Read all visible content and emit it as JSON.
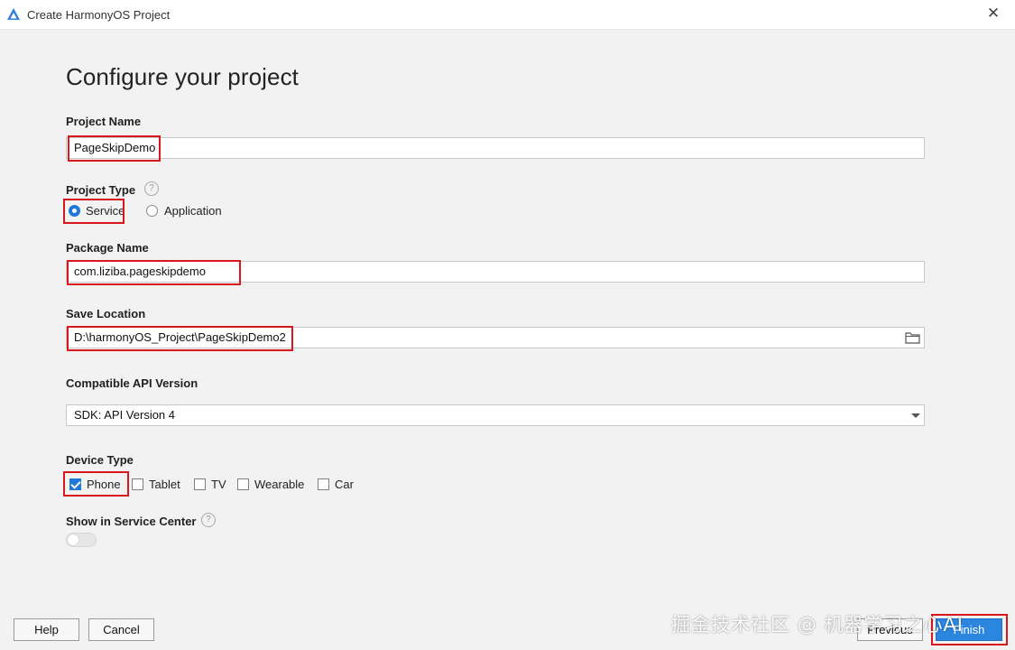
{
  "window": {
    "title": "Create HarmonyOS Project"
  },
  "page": {
    "title": "Configure your project"
  },
  "project_name": {
    "label": "Project Name",
    "value": "PageSkipDemo"
  },
  "project_type": {
    "label": "Project Type",
    "options": [
      {
        "label": "Service",
        "selected": true
      },
      {
        "label": "Application",
        "selected": false
      }
    ]
  },
  "package_name": {
    "label": "Package Name",
    "value": "com.liziba.pageskipdemo"
  },
  "save_location": {
    "label": "Save Location",
    "value": "D:\\harmonyOS_Project\\PageSkipDemo2"
  },
  "api_version": {
    "label": "Compatible API Version",
    "selected": "SDK: API Version 4"
  },
  "device_type": {
    "label": "Device Type",
    "options": [
      {
        "label": "Phone",
        "checked": true
      },
      {
        "label": "Tablet",
        "checked": false
      },
      {
        "label": "TV",
        "checked": false
      },
      {
        "label": "Wearable",
        "checked": false
      },
      {
        "label": "Car",
        "checked": false
      }
    ]
  },
  "service_center": {
    "label": "Show in Service Center",
    "enabled": false
  },
  "buttons": {
    "help": "Help",
    "cancel": "Cancel",
    "previous": "Previous",
    "finish": "Finish"
  },
  "watermark": "掘金技术社区 @ 机器学习之心AI",
  "colors": {
    "accent": "#2b86e0",
    "highlight_box": "#d9181e",
    "background": "#f2f2f2"
  },
  "icons": [
    "harmonyos-logo-icon",
    "close-icon",
    "help-icon",
    "folder-icon",
    "chevron-down-icon"
  ]
}
